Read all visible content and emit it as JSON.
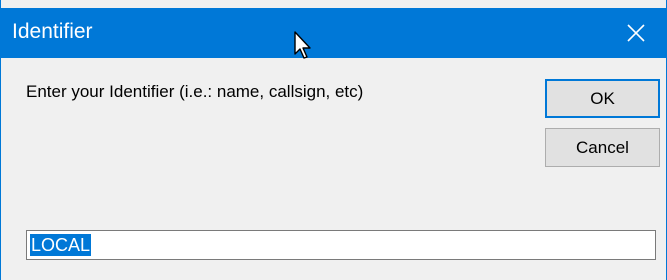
{
  "window": {
    "title": "Identifier",
    "close_icon": "close-icon"
  },
  "dialog": {
    "prompt": "Enter your Identifier (i.e.: name, callsign, etc)",
    "ok_label": "OK",
    "cancel_label": "Cancel",
    "identifier_value": "LOCAL"
  },
  "colors": {
    "titlebar": "#0078d7",
    "body": "#f0f0f0",
    "selection": "#0078d7"
  }
}
